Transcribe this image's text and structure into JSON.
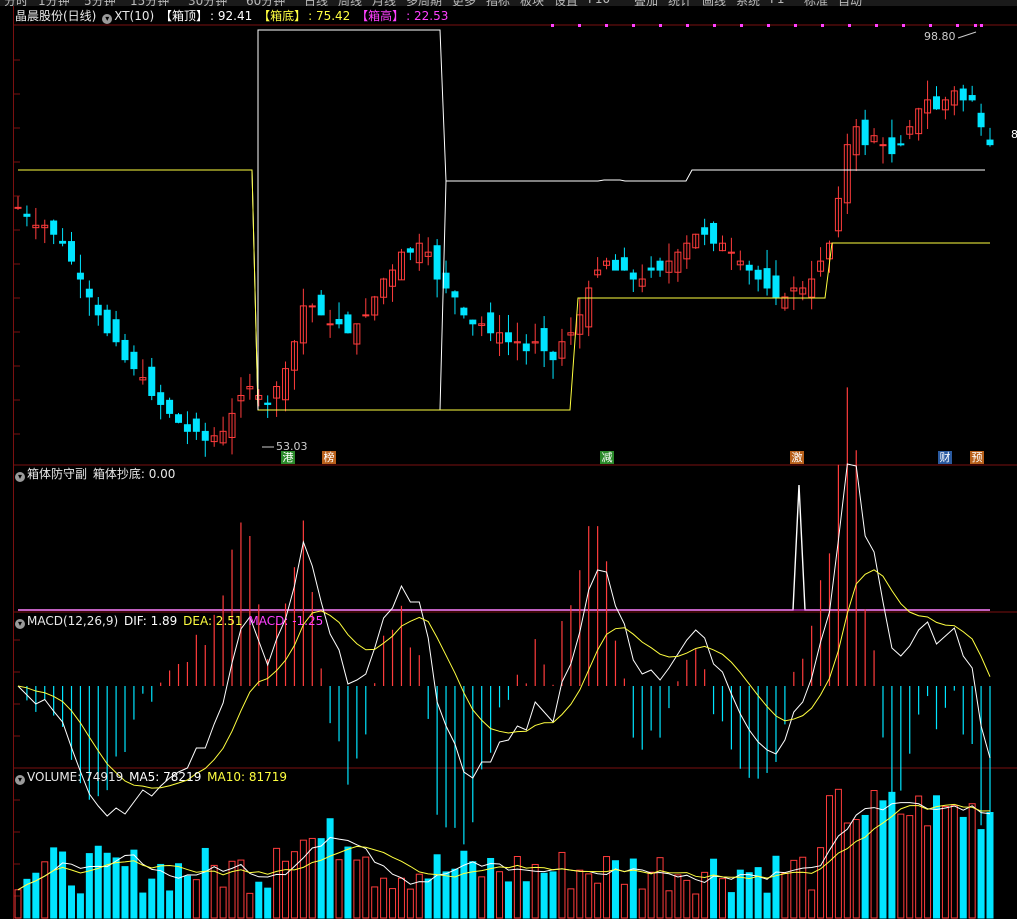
{
  "topbar": {
    "items": [
      "分时",
      "1分钟",
      "5分钟",
      "15分钟",
      "30分钟",
      "60分钟",
      "日线",
      "周线",
      "月线",
      "多周期",
      "更多",
      "指标",
      "板块",
      "设置",
      "F10",
      "叠加",
      "统计",
      "画线",
      "系统",
      "F1",
      "标准",
      "自动"
    ]
  },
  "main_header": {
    "stock": "晶晨股份(日线)",
    "indicator": "XT(10)",
    "box_top_label": "【箱顶】",
    "box_top_value": ": 92.41",
    "box_bottom_label": "【箱底】",
    "box_bottom_value": ": 75.42",
    "box_high_label": "【箱高】",
    "box_high_value": ": 22.53"
  },
  "price_annotations": {
    "high": "98.80",
    "low": "53.03",
    "right_edge": "8"
  },
  "event_tags": [
    {
      "text": "港",
      "color": "#2a8a2a"
    },
    {
      "text": "榜",
      "color": "#b8601a"
    },
    {
      "text": "减",
      "color": "#2a8a2a"
    },
    {
      "text": "激",
      "color": "#b8601a"
    },
    {
      "text": "财",
      "color": "#2a5aa0"
    },
    {
      "text": "预",
      "color": "#b8601a"
    }
  ],
  "sub1_header": {
    "name": "箱体防守副",
    "field": "箱体抄底: 0.00"
  },
  "macd_header": {
    "name": "MACD(12,26,9)",
    "dif": "DIF: 1.89",
    "dea": "DEA: 2.51",
    "macd": "MACD: -1.25"
  },
  "vol_header": {
    "name": "VOLUME: 74919",
    "ma5": "MA5: 78219",
    "ma10": "MA10: 81719"
  },
  "colors": {
    "up": "#ff3c3c",
    "down": "#00e5ff",
    "yellow": "#ffff40",
    "magenta": "#ff40ff",
    "white": "#ffffff",
    "grid": "#7a1010"
  },
  "chart_data": {
    "type": "candlestick",
    "y_range": [
      53.03,
      98.8
    ],
    "closes": [
      79,
      78,
      77,
      77,
      76,
      75,
      73,
      71,
      69,
      67,
      65,
      64,
      62,
      61,
      60,
      58,
      57,
      56,
      55,
      54,
      54,
      53,
      53.5,
      54,
      56,
      58,
      59,
      58,
      57,
      59,
      61,
      64,
      68,
      68,
      67,
      66,
      66,
      65,
      66,
      67,
      69,
      71,
      72,
      74,
      74,
      75,
      74,
      71,
      70,
      69,
      67,
      66,
      66,
      65,
      65,
      64,
      64,
      63,
      64,
      63,
      62,
      64,
      65,
      67,
      70,
      72,
      73,
      72,
      72,
      71,
      71,
      72,
      72,
      73,
      74,
      75,
      76,
      76,
      75,
      75,
      74,
      73,
      72,
      71,
      70,
      69,
      69,
      70,
      70,
      71,
      73,
      75,
      80,
      86,
      88,
      86,
      87,
      86,
      85,
      86,
      88,
      90,
      91,
      90,
      91,
      92,
      91,
      91,
      88,
      86
    ],
    "vol_range": [
      0,
      100000
    ]
  }
}
